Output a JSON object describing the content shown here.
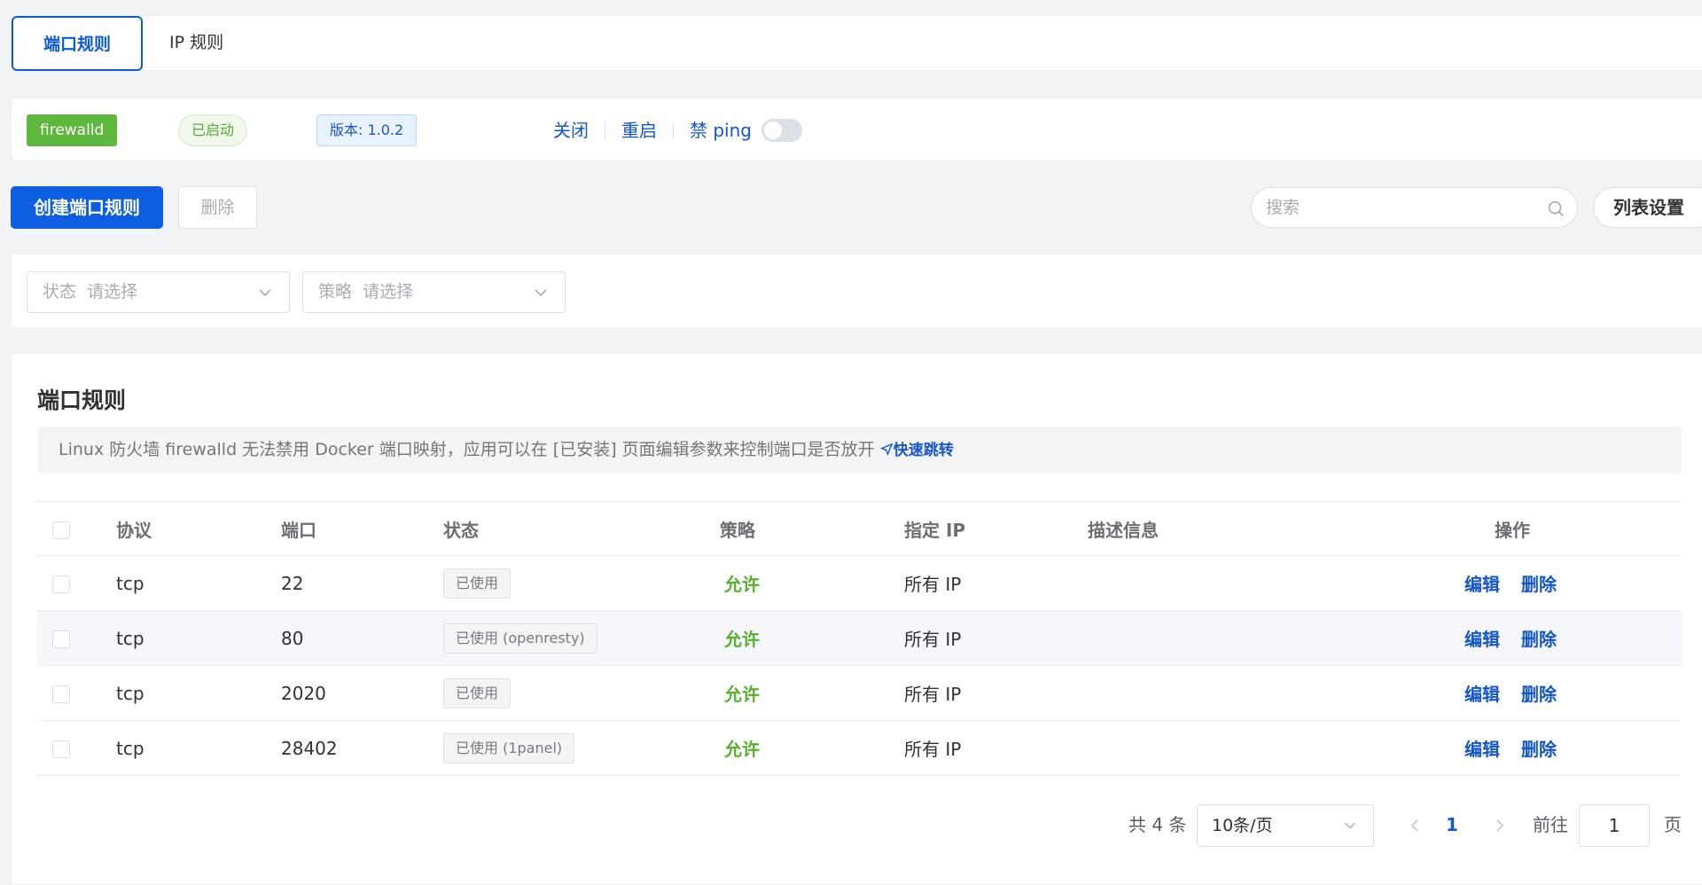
{
  "tabs": [
    {
      "label": "端口规则",
      "active": true
    },
    {
      "label": "IP 规则",
      "active": false
    }
  ],
  "status": {
    "service_name": "firewalld",
    "state": "已启动",
    "version": "版本: 1.0.2",
    "actions": [
      "关闭",
      "重启",
      "禁 ping"
    ],
    "ping_disabled": false
  },
  "toolbar": {
    "create_label": "创建端口规则",
    "delete_label": "删除",
    "search_placeholder": "搜索",
    "list_settings_label": "列表设置"
  },
  "filters": [
    {
      "label": "状态",
      "placeholder": "请选择"
    },
    {
      "label": "策略",
      "placeholder": "请选择"
    }
  ],
  "section": {
    "title": "端口规则",
    "notice": "Linux 防火墙 firewalld 无法禁用 Docker 端口映射，应用可以在 [已安装] 页面编辑参数来控制端口是否放开",
    "notice_link": "快速跳转"
  },
  "table": {
    "columns": [
      "协议",
      "端口",
      "状态",
      "策略",
      "指定 IP",
      "描述信息",
      "操作"
    ],
    "rows": [
      {
        "protocol": "tcp",
        "port": "22",
        "status": "已使用",
        "policy": "允许",
        "ip": "所有 IP",
        "description": "",
        "edit": "编辑",
        "delete": "删除"
      },
      {
        "protocol": "tcp",
        "port": "80",
        "status": "已使用 (openresty)",
        "policy": "允许",
        "ip": "所有 IP",
        "description": "",
        "edit": "编辑",
        "delete": "删除"
      },
      {
        "protocol": "tcp",
        "port": "2020",
        "status": "已使用",
        "policy": "允许",
        "ip": "所有 IP",
        "description": "",
        "edit": "编辑",
        "delete": "删除"
      },
      {
        "protocol": "tcp",
        "port": "28402",
        "status": "已使用 (1panel)",
        "policy": "允许",
        "ip": "所有 IP",
        "description": "",
        "edit": "编辑",
        "delete": "删除"
      }
    ]
  },
  "pagination": {
    "total": "共 4 条",
    "page_size": "10条/页",
    "current_page": "1",
    "goto_label": "前往",
    "goto_value": "1",
    "unit": "页"
  },
  "colors": {
    "primary": "#0d5ee0",
    "success": "#5fb83e",
    "link": "#1456cc"
  }
}
